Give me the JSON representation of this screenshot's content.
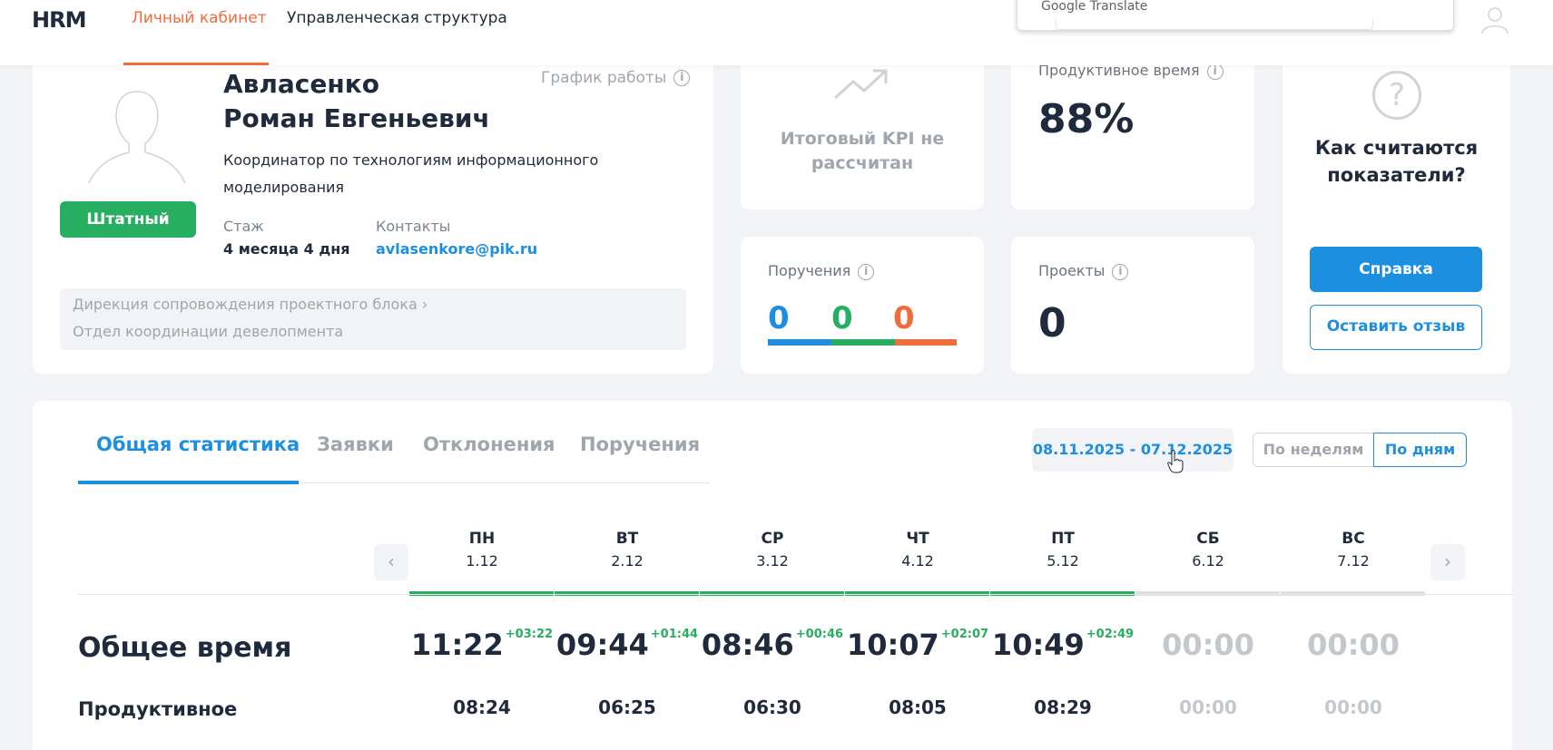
{
  "header": {
    "logo": "HRM",
    "nav": [
      {
        "label": "Личный кабинет",
        "active": true
      },
      {
        "label": "Управленческая структура",
        "active": false
      }
    ],
    "translate_popup": "Google Translate"
  },
  "profile": {
    "last_name": "Авласенко",
    "first_names": "Роман Евгеньевич",
    "schedule_label": "График работы",
    "position": "Координатор по технологиям информационного моделирования",
    "status_badge": "Штатный",
    "tenure_label": "Стаж",
    "tenure_value": "4 месяца 4 дня",
    "contacts_label": "Контакты",
    "email": "avlasenkore@pik.ru",
    "department_path": "Дирекция сопровождения проектного блока",
    "department_sub": "Отдел координации девелопмента"
  },
  "kpi": {
    "text_line1": "Итоговый KPI не",
    "text_line2": "рассчитан"
  },
  "productive": {
    "label": "Продуктивное время",
    "value": "88%"
  },
  "orders": {
    "label": "Поручения",
    "blue": "0",
    "green": "0",
    "orange": "0"
  },
  "projects": {
    "label": "Проекты",
    "value": "0"
  },
  "help": {
    "title_line1": "Как считаются",
    "title_line2": "показатели?",
    "help_button": "Справка",
    "feedback_button": "Оставить отзыв"
  },
  "stats": {
    "tabs": [
      {
        "label": "Общая статистика",
        "active": true
      },
      {
        "label": "Заявки",
        "active": false
      },
      {
        "label": "Отклонения",
        "active": false
      },
      {
        "label": "Поручения",
        "active": false
      }
    ],
    "date_range": "08.11.2025 - 07.12.2025",
    "toggle_weeks": "По неделям",
    "toggle_days": "По дням",
    "days": [
      {
        "name": "ПН",
        "date": "1.12",
        "total": "11:22",
        "diff": "+03:22",
        "productive": "08:24",
        "worked": true
      },
      {
        "name": "ВТ",
        "date": "2.12",
        "total": "09:44",
        "diff": "+01:44",
        "productive": "06:25",
        "worked": true
      },
      {
        "name": "СР",
        "date": "3.12",
        "total": "08:46",
        "diff": "+00:46",
        "productive": "06:30",
        "worked": true
      },
      {
        "name": "ЧТ",
        "date": "4.12",
        "total": "10:07",
        "diff": "+02:07",
        "productive": "08:05",
        "worked": true
      },
      {
        "name": "ПТ",
        "date": "5.12",
        "total": "10:49",
        "diff": "+02:49",
        "productive": "08:29",
        "worked": true
      },
      {
        "name": "СБ",
        "date": "6.12",
        "total": "00:00",
        "diff": "",
        "productive": "00:00",
        "worked": false
      },
      {
        "name": "ВС",
        "date": "7.12",
        "total": "00:00",
        "diff": "",
        "productive": "00:00",
        "worked": false
      }
    ],
    "row_total_label": "Общее время",
    "row_productive_label": "Продуктивное"
  },
  "colors": {
    "accent": "#1d8fe1",
    "brand_orange": "#f26b3a",
    "success": "#27ae60",
    "muted": "#a0a6ae"
  }
}
